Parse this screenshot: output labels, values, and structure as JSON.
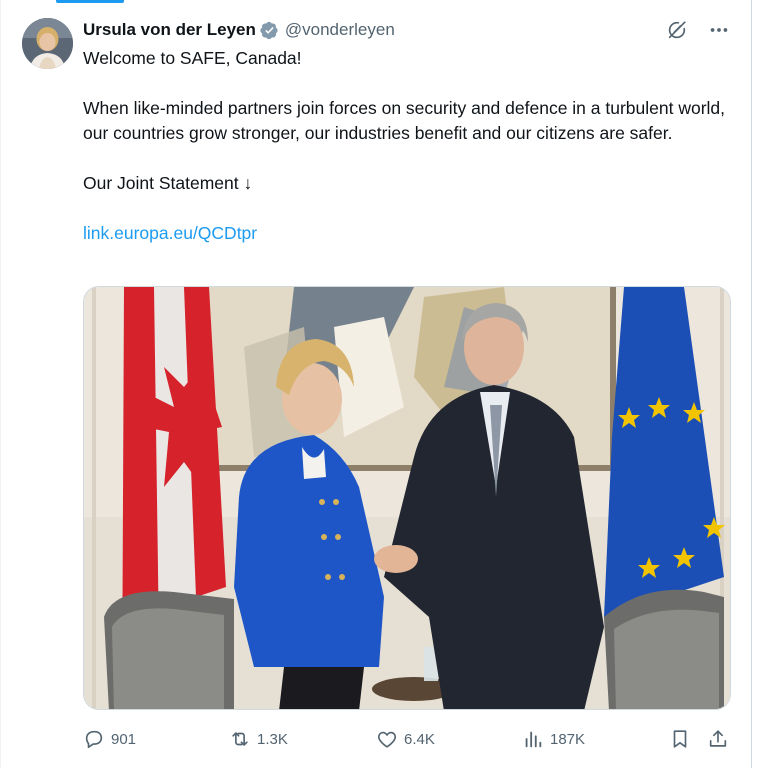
{
  "tweet": {
    "author_name": "Ursula von der Leyen",
    "author_handle": "@vonderleyen",
    "verified": true,
    "lines": [
      "Welcome to SAFE, Canada!",
      "When like-minded partners join forces on security and defence in a turbulent world, our countries grow stronger, our industries benefit and our citizens are safer.",
      "Our Joint Statement ↓"
    ],
    "link_text": "link.europa.eu/QCDtpr"
  },
  "header_icons": [
    "grok-icon",
    "more-icon"
  ],
  "actions": {
    "replies": "901",
    "reposts": "1.3K",
    "likes": "6.4K",
    "views": "187K"
  },
  "colors": {
    "accent": "#1d9bf0",
    "secondary_text": "#536471",
    "primary_text": "#0f1419",
    "verified_badge": "#829aab"
  }
}
